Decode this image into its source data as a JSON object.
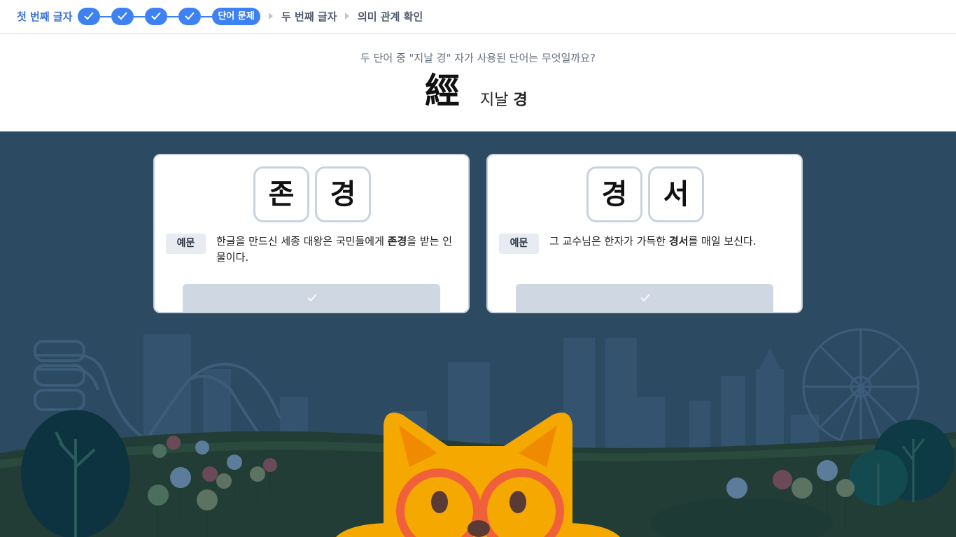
{
  "progress": {
    "first_label": "첫 번째 글자",
    "completed_steps": 4,
    "current_label": "단어 문제",
    "next_label": "두 번째 글자",
    "last_label": "의미 관계 확인",
    "accent_color": "#3d82f0"
  },
  "question": {
    "prompt": "두 단어 중 \"지날 경\" 자가 사용된 단어는 무엇일까요?",
    "hanja": "經",
    "meaning": "지날",
    "sound": "경"
  },
  "choices": [
    {
      "syllables": [
        "존",
        "경"
      ],
      "example_badge": "예문",
      "example_before": "한글을 만드신 세종 대왕은 국민들에게 ",
      "example_word": "존경",
      "example_after": "을 받는 인물이다.",
      "button_icon": "check-icon"
    },
    {
      "syllables": [
        "경",
        "서"
      ],
      "example_badge": "예문",
      "example_before": "그 교수님은 한자가 가득한 ",
      "example_word": "경서",
      "example_after": "를 매일 보신다.",
      "button_icon": "check-icon"
    }
  ],
  "colors": {
    "scene_background": "#2d4a63",
    "mascot": "#f5a800",
    "glasses": "#f0603a"
  }
}
